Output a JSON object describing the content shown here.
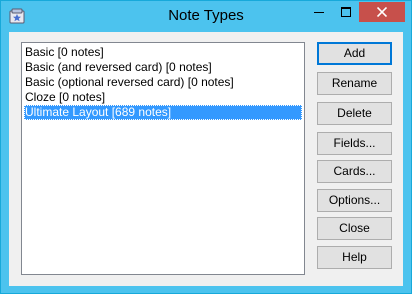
{
  "window": {
    "title": "Note Types"
  },
  "note_types": [
    {
      "label": "Basic [0 notes]",
      "selected": false
    },
    {
      "label": "Basic (and reversed card) [0 notes]",
      "selected": false
    },
    {
      "label": "Basic (optional reversed card) [0 notes]",
      "selected": false
    },
    {
      "label": "Cloze [0 notes]",
      "selected": false
    },
    {
      "label": "Ultimate Layout [689 notes]",
      "selected": true
    }
  ],
  "buttons": {
    "add": "Add",
    "rename": "Rename",
    "delete": "Delete",
    "fields": "Fields...",
    "cards": "Cards...",
    "options": "Options...",
    "close": "Close",
    "help": "Help"
  },
  "colors": {
    "title_bar": "#4cc3ee",
    "close_button": "#c7504b",
    "selection": "#3399ff",
    "dialog_background": "#f0f0f0"
  },
  "icons": {
    "app": "anki-app-icon",
    "minimize": "minimize-icon",
    "maximize": "maximize-icon",
    "close": "close-icon"
  }
}
